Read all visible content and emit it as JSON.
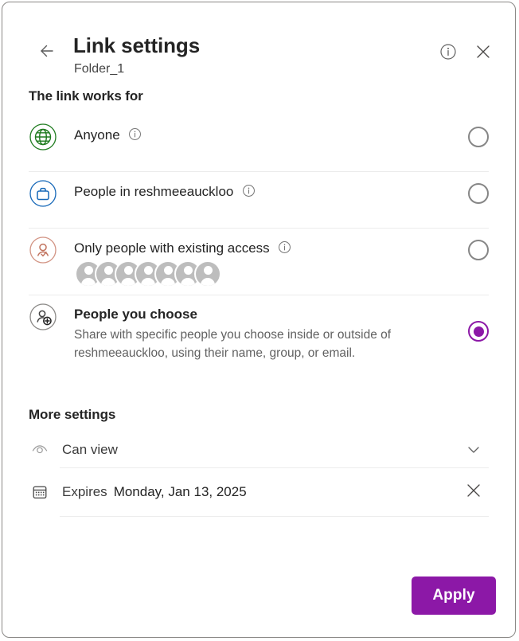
{
  "dialog": {
    "title": "Link settings",
    "subtitle": "Folder_1",
    "back_icon": "arrow-left-icon",
    "info_icon": "info-icon",
    "close_icon": "close-icon"
  },
  "link_works_for": {
    "heading": "The link works for",
    "options": [
      {
        "id": "anyone",
        "label": "Anyone",
        "icon": "globe-icon",
        "icon_color": "#107C10",
        "has_info": true,
        "selected": false,
        "description": ""
      },
      {
        "id": "people-in-org",
        "label": "People in reshmeeauckloo",
        "icon": "briefcase-icon",
        "icon_color": "#0F6CBD",
        "has_info": true,
        "selected": false,
        "description": ""
      },
      {
        "id": "existing-access",
        "label": "Only people with existing access",
        "icon": "person-check-icon",
        "icon_color": "#C77B6A",
        "has_info": true,
        "selected": false,
        "description": "",
        "avatar_count": 7
      },
      {
        "id": "people-you-choose",
        "label": "People you choose",
        "icon": "person-add-icon",
        "icon_color": "#616161",
        "has_info": false,
        "selected": true,
        "description": "Share with specific people you choose inside or outside of reshmeeauckloo, using their name, group, or email."
      }
    ]
  },
  "more_settings": {
    "heading": "More settings",
    "permission": {
      "icon": "eye-icon",
      "value": "Can view",
      "chevron_icon": "chevron-down-icon"
    },
    "expiration": {
      "icon": "calendar-icon",
      "label": "Expires",
      "value": "Monday, Jan 13, 2025",
      "clear_icon": "close-icon"
    }
  },
  "footer": {
    "apply_label": "Apply"
  },
  "colors": {
    "accent": "#8c18a7",
    "text_primary": "#242424",
    "text_secondary": "#616161"
  }
}
